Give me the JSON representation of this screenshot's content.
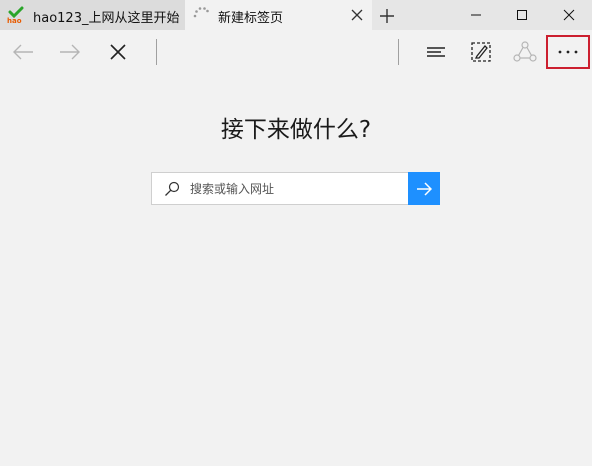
{
  "tabs": [
    {
      "title": "hao123_上网从这里开始",
      "icon": "hao123-logo-icon"
    },
    {
      "title": "新建标签页",
      "icon": "loading-spinner-icon"
    }
  ],
  "newtab_icon": "plus-icon",
  "window_controls": [
    "minimize-icon",
    "maximize-icon",
    "close-icon"
  ],
  "toolbar": {
    "left": [
      "back-arrow-icon",
      "forward-arrow-icon",
      "stop-icon"
    ],
    "right": [
      "hub-icon",
      "web-note-icon",
      "share-icon",
      "more-icon"
    ],
    "highlight_color": "#cc1f2f"
  },
  "main": {
    "heading": "接下来做什么?",
    "search_placeholder": "搜索或输入网址",
    "go_button_color": "#1e90ff"
  }
}
